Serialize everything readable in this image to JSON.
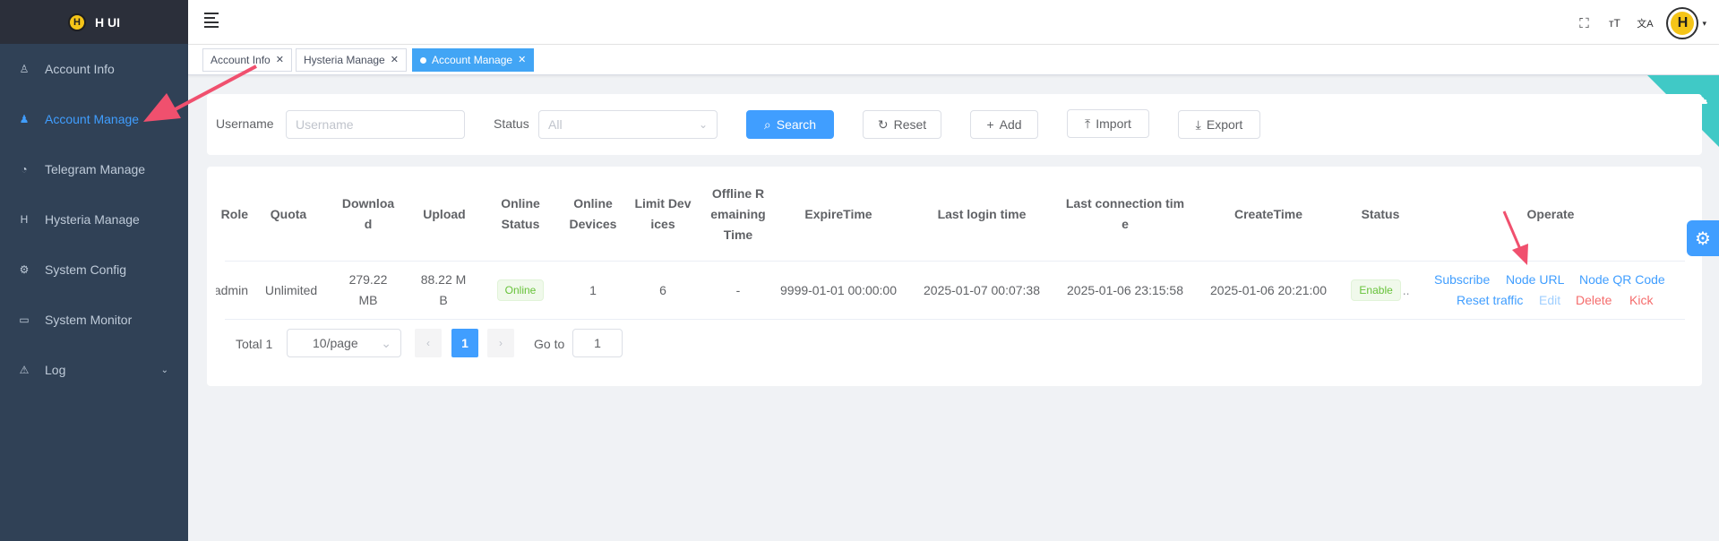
{
  "app": {
    "title": "H UI",
    "logo_letter": "H"
  },
  "sidebar": {
    "items": [
      {
        "label": "Account Info",
        "icon": "user-icon",
        "glyph": "♙",
        "active": false
      },
      {
        "label": "Account Manage",
        "icon": "users-icon",
        "glyph": "♟",
        "active": true
      },
      {
        "label": "Telegram Manage",
        "icon": "bell-icon",
        "glyph": "◔",
        "active": false
      },
      {
        "label": "Hysteria Manage",
        "icon": "h-icon",
        "glyph": "H",
        "active": false
      },
      {
        "label": "System Config",
        "icon": "gear-icon",
        "glyph": "⚙",
        "active": false
      },
      {
        "label": "System Monitor",
        "icon": "monitor-icon",
        "glyph": "▭",
        "active": false
      },
      {
        "label": "Log",
        "icon": "warning-icon",
        "glyph": "⚠",
        "active": false,
        "caret": "⌄"
      }
    ]
  },
  "header": {
    "icons": [
      "fullscreen-icon",
      "font-size-icon",
      "translate-icon"
    ],
    "icon_glyphs": [
      "⛶",
      "ᴛT",
      "文A"
    ],
    "avatar_letter": "H"
  },
  "tags": [
    {
      "label": "Account Info",
      "active": false
    },
    {
      "label": "Hysteria Manage",
      "active": false
    },
    {
      "label": "Account Manage",
      "active": true
    }
  ],
  "search": {
    "username_label": "Username",
    "username_placeholder": "Username",
    "status_label": "Status",
    "status_placeholder": "All",
    "search_btn": "Search",
    "reset_btn": "Reset",
    "add_btn": "Add",
    "import_btn": "Import",
    "export_btn": "Export"
  },
  "table": {
    "headers": {
      "role": "Role",
      "quota": "Quota",
      "download": "Download",
      "upload": "Upload",
      "online_status": "Online Status",
      "online_devices": "Online Devices",
      "limit_devices": "Limit Devices",
      "offline_remaining": "Offline Remaining Time",
      "expire": "ExpireTime",
      "last_login": "Last login time",
      "last_conn": "Last connection time",
      "create": "CreateTime",
      "status": "Status",
      "operate": "Operate"
    },
    "row": {
      "role": "admin",
      "quota": "Unlimited",
      "download": "279.22 MB",
      "upload": "88.22 MB",
      "online_status": "Online",
      "online_devices": "1",
      "limit_devices": "6",
      "offline_remaining": "-",
      "expire": "9999-01-01 00:00:00",
      "last_login": "2025-01-07 00:07:38",
      "last_conn": "2025-01-06 23:15:58",
      "create": "2025-01-06 20:21:00",
      "status": "Enable",
      "ops": {
        "subscribe": "Subscribe",
        "node_url": "Node URL",
        "node_qr": "Node QR Code",
        "reset_traffic": "Reset traffic",
        "edit": "Edit",
        "delete": "Delete",
        "kick": "Kick"
      }
    }
  },
  "pagination": {
    "total": "Total 1",
    "page_size": "10/page",
    "current_page": "1",
    "goto_label": "Go to",
    "goto_value": "1"
  },
  "colors": {
    "sidebar": "#304156",
    "primary": "#409eff",
    "annotation": "#f0506e"
  }
}
